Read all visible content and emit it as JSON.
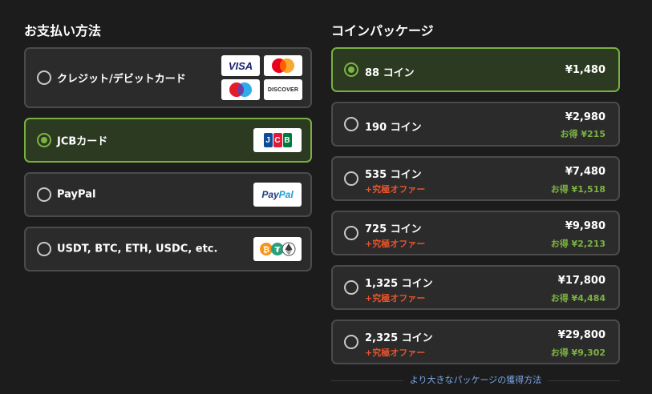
{
  "payment": {
    "heading": "お支払い方法",
    "methods": [
      {
        "label": "クレジット/デビットカード",
        "selected": false
      },
      {
        "label": "JCBカード",
        "selected": true
      },
      {
        "label": "PayPal",
        "selected": false
      },
      {
        "label": "USDT, BTC, ETH, USDC, etc.",
        "selected": false
      }
    ],
    "logos": {
      "visa": "VISA",
      "discover": "DISCOVER",
      "jcb": "JCB",
      "paypal_pay": "Pay",
      "paypal_pal": "Pal"
    }
  },
  "coins": {
    "heading": "コインパッケージ",
    "packages": [
      {
        "name": "88 コイン",
        "price": "¥1,480",
        "offer": "",
        "save": "",
        "selected": true
      },
      {
        "name": "190 コイン",
        "price": "¥2,980",
        "offer": "",
        "save": "お得 ¥215",
        "selected": false
      },
      {
        "name": "535 コイン",
        "price": "¥7,480",
        "offer": "+究極オファー",
        "save": "お得 ¥1,518",
        "selected": false
      },
      {
        "name": "725 コイン",
        "price": "¥9,980",
        "offer": "+究極オファー",
        "save": "お得 ¥2,213",
        "selected": false
      },
      {
        "name": "1,325 コイン",
        "price": "¥17,800",
        "offer": "+究極オファー",
        "save": "お得 ¥4,484",
        "selected": false
      },
      {
        "name": "2,325 コイン",
        "price": "¥29,800",
        "offer": "+究極オファー",
        "save": "お得 ¥9,302",
        "selected": false
      }
    ],
    "more_link": "より大きなパッケージの獲得方法"
  },
  "colors": {
    "background": "#1c1c1c",
    "card": "#2b2b2b",
    "selected_card": "#2b3a20",
    "selected_border": "#78b040",
    "accent_green": "#7cb342",
    "offer_red": "#e5532c",
    "link_blue": "#7aa6e6"
  }
}
